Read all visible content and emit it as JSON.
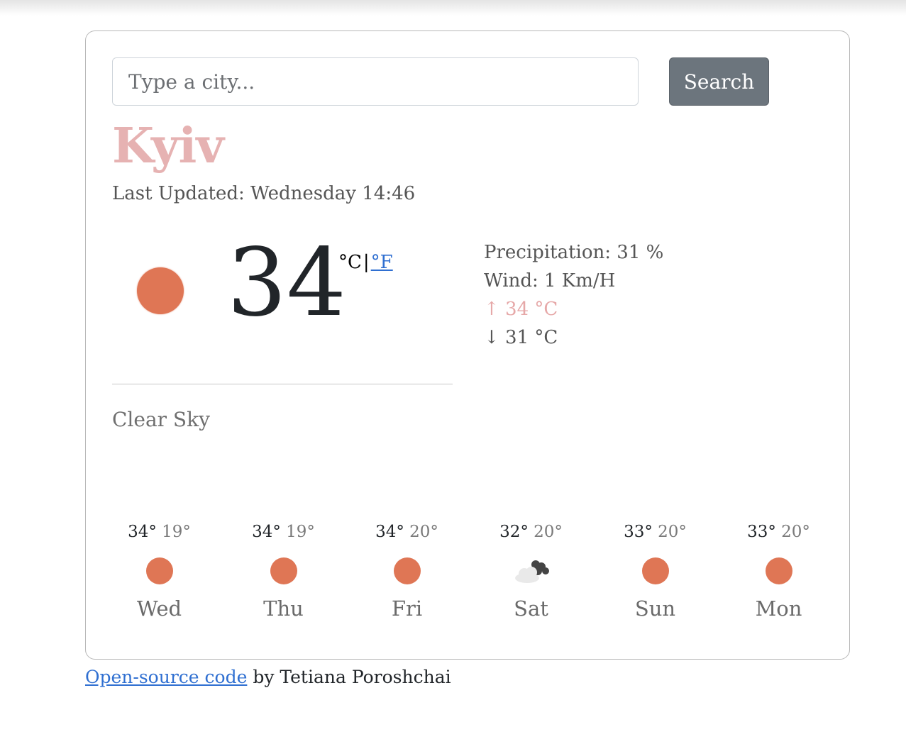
{
  "search": {
    "placeholder": "Type a city...",
    "button_label": "Search"
  },
  "current": {
    "city": "Kyiv",
    "last_updated": "Last Updated: Wednesday 14:46",
    "temperature": "34",
    "unit_celsius": "°C",
    "unit_separator": "|",
    "unit_fahrenheit": "°F",
    "precipitation": "Precipitation: 31 %",
    "wind": "Wind: 1 Km/H",
    "max": "↑ 34 °C",
    "min": "↓ 31 °C",
    "description": "Clear Sky",
    "icon": "sun-icon",
    "colors": {
      "city": "#e6b2b2",
      "sun": "#df7655",
      "max_temp": "#e6a8a8",
      "search_button": "#6c757d",
      "link": "#2f6fd1"
    }
  },
  "forecast": [
    {
      "day": "Wed",
      "max": "34°",
      "min": "19°",
      "icon": "sun-icon"
    },
    {
      "day": "Thu",
      "max": "34°",
      "min": "19°",
      "icon": "sun-icon"
    },
    {
      "day": "Fri",
      "max": "34°",
      "min": "20°",
      "icon": "sun-icon"
    },
    {
      "day": "Sat",
      "max": "32°",
      "min": "20°",
      "icon": "cloud-icon"
    },
    {
      "day": "Sun",
      "max": "33°",
      "min": "20°",
      "icon": "sun-icon"
    },
    {
      "day": "Mon",
      "max": "33°",
      "min": "20°",
      "icon": "sun-icon"
    }
  ],
  "footer": {
    "link_text": "Open-source code",
    "suffix": " by Tetiana Poroshchai"
  }
}
